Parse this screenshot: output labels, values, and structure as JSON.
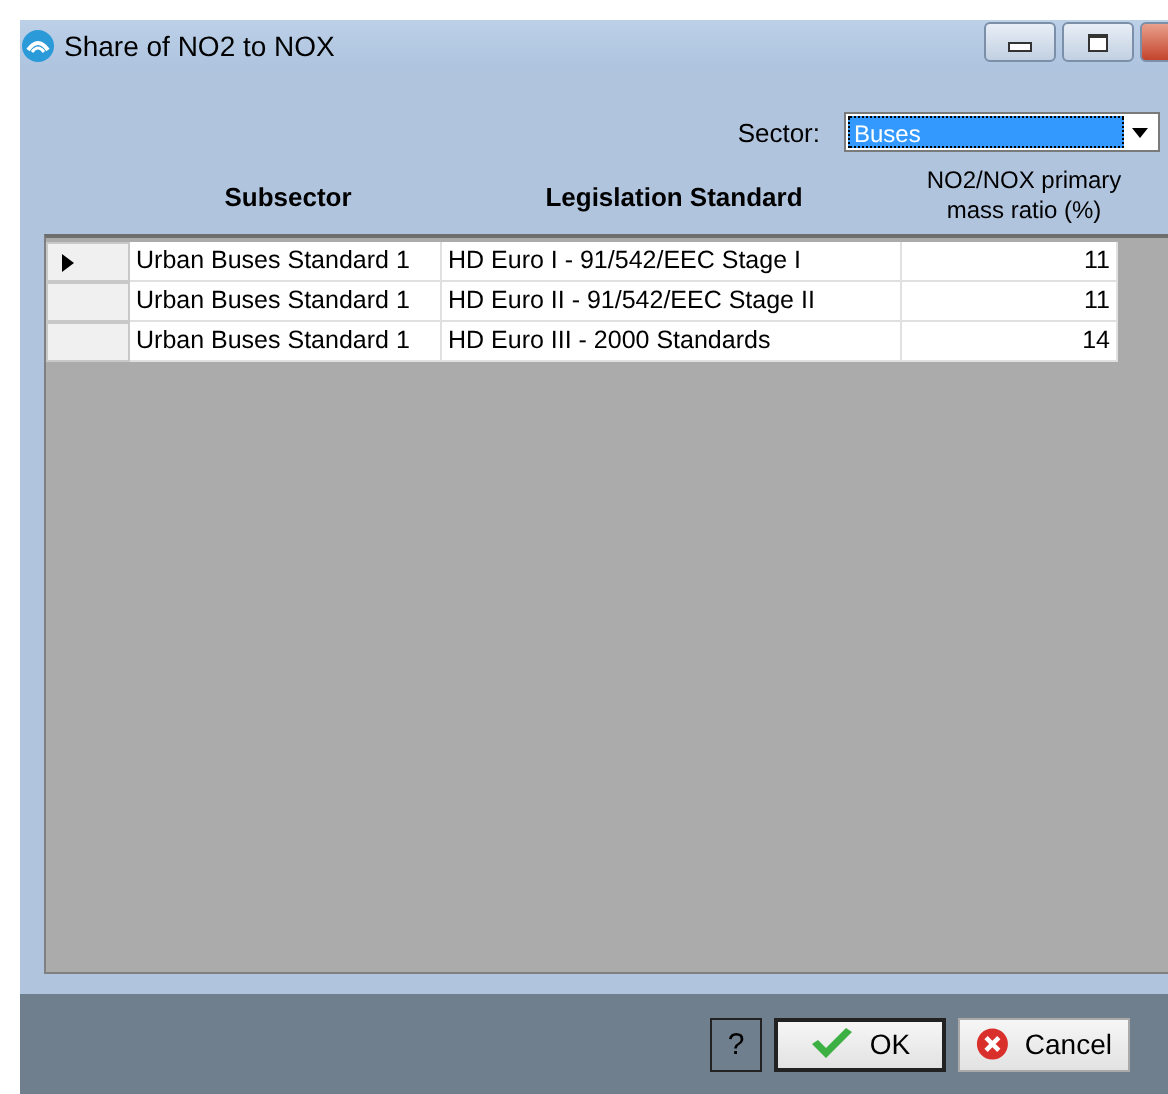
{
  "window": {
    "title": "Share of NO2 to NOX"
  },
  "sector": {
    "label": "Sector:",
    "value": "Buses"
  },
  "table": {
    "columns": [
      "Subsector",
      "Legislation Standard",
      "NO2/NOX primary mass ratio (%)"
    ],
    "rows": [
      {
        "selected": true,
        "cells": [
          "Urban Buses Standard 1",
          "HD Euro I - 91/542/EEC Stage I",
          "11"
        ]
      },
      {
        "selected": false,
        "cells": [
          "Urban Buses Standard 1",
          "HD Euro II - 91/542/EEC Stage II",
          "11"
        ]
      },
      {
        "selected": false,
        "cells": [
          "Urban Buses Standard 1",
          "HD Euro III - 2000 Standards",
          "14"
        ]
      }
    ]
  },
  "buttons": {
    "help": "?",
    "ok": "OK",
    "cancel": "Cancel"
  }
}
